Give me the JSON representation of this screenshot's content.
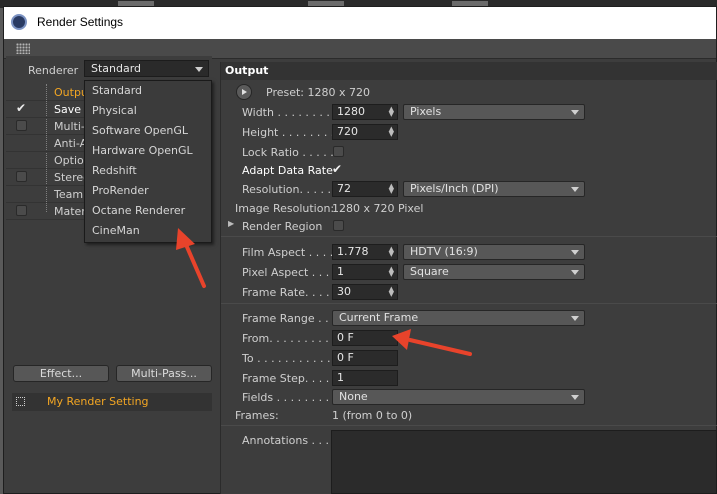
{
  "window": {
    "title": "Render Settings"
  },
  "left": {
    "renderer_label": "Renderer",
    "renderer_value": "Standard",
    "tree": [
      {
        "label": "Output",
        "checked": null,
        "active": true
      },
      {
        "label": "Save",
        "checked": true,
        "active": false
      },
      {
        "label": "Multi-",
        "checked": false,
        "active": false
      },
      {
        "label": "Anti-A",
        "checked": null,
        "active": false
      },
      {
        "label": "Option",
        "checked": null,
        "active": false
      },
      {
        "label": "Stereo",
        "checked": false,
        "active": false
      },
      {
        "label": "Team",
        "checked": null,
        "active": false
      },
      {
        "label": "Mater",
        "checked": false,
        "active": false
      }
    ],
    "effect_button": "Effect...",
    "multipass_button": "Multi-Pass...",
    "setting_name": "My Render Setting"
  },
  "dropdown": {
    "items": [
      "Standard",
      "Physical",
      "Software OpenGL",
      "Hardware OpenGL",
      "Redshift",
      "ProRender",
      "Octane Renderer",
      "CineMan"
    ]
  },
  "output": {
    "header": "Output",
    "preset": "Preset: 1280 x 720",
    "width_label": "Width . . . . . . . . .",
    "width_value": "1280",
    "width_unit": "Pixels",
    "height_label": "Height . . . . . . . .",
    "height_value": "720",
    "lock_ratio_label": "Lock Ratio . . . . .",
    "adapt_label": "Adapt Data Rate",
    "resolution_label": "Resolution. . . . .",
    "resolution_value": "72",
    "resolution_unit": "Pixels/Inch (DPI)",
    "image_resolution_label": "Image Resolution:",
    "image_resolution_value": "1280 x 720 Pixel",
    "render_region_label": "Render Region",
    "film_aspect_label": "Film Aspect . . . .",
    "film_aspect_value": "1.778",
    "film_aspect_preset": "HDTV (16:9)",
    "pixel_aspect_label": "Pixel Aspect . . . .",
    "pixel_aspect_value": "1",
    "pixel_aspect_preset": "Square",
    "frame_rate_label": "Frame Rate. . . . .",
    "frame_rate_value": "30",
    "frame_range_label": "Frame Range . . .",
    "frame_range_value": "Current Frame",
    "from_label": "From. . . . . . . . . .",
    "from_value": "0 F",
    "to_label": "To . . . . . . . . . . . .",
    "to_value": "0 F",
    "frame_step_label": "Frame Step. . . . .",
    "frame_step_value": "1",
    "fields_label": "Fields . . . . . . . . .",
    "fields_value": "None",
    "frames_label": "Frames:",
    "frames_value": "1 (from 0 to 0)",
    "annotations_label": "Annotations . . ."
  },
  "colors": {
    "accent": "#f3a623",
    "arrow": "#e8432b"
  }
}
